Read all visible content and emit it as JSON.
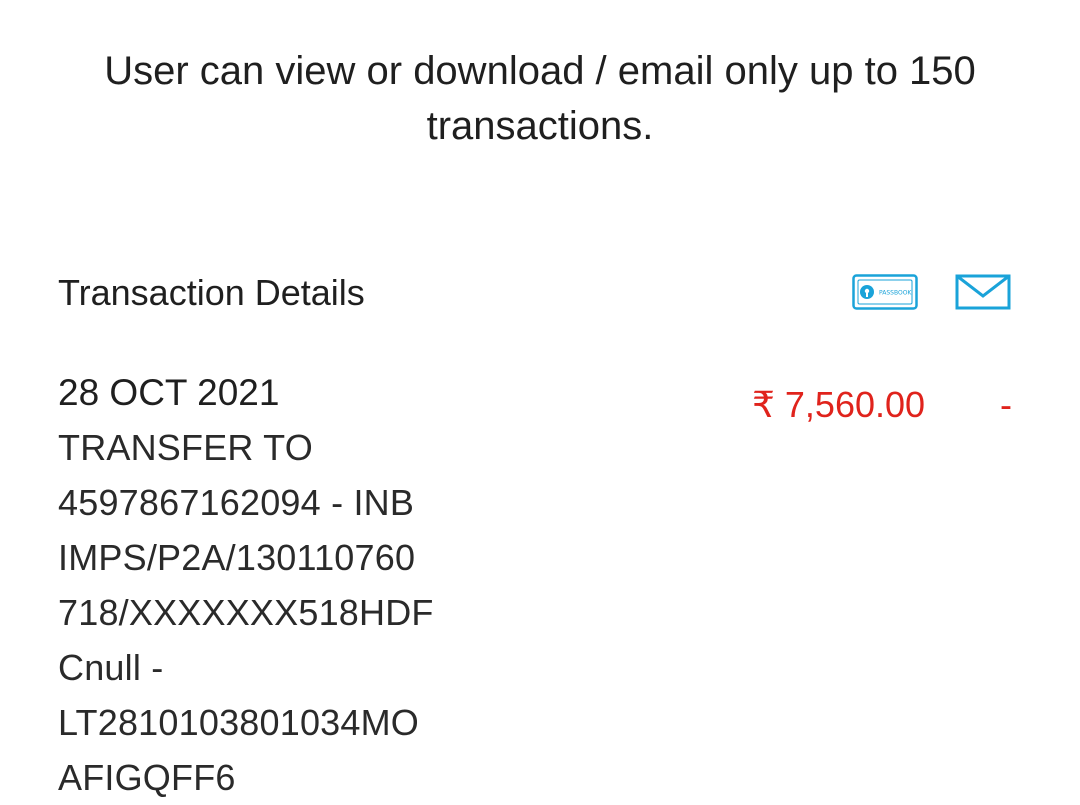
{
  "notice": {
    "line1": "User can view or download / email only up to 150",
    "line2": "transactions."
  },
  "header": {
    "title": "Transaction Details",
    "passbook_label": "PASSBOOK",
    "passbook_icon": "passbook-icon",
    "mail_icon": "mail-icon",
    "accent_color": "#1aa3d9"
  },
  "transactions": [
    {
      "date": "28 OCT 2021",
      "description_lines": [
        "TRANSFER TO",
        "4597867162094 - INB",
        "IMPS/P2A/130110760",
        "718/XXXXXXX518HDF",
        "Cnull -",
        "LT2810103801034MO",
        "AFIGQFF6"
      ],
      "amount": "₹ 7,560.00",
      "balance_marker": "-",
      "amount_color": "#e0231c"
    }
  ]
}
